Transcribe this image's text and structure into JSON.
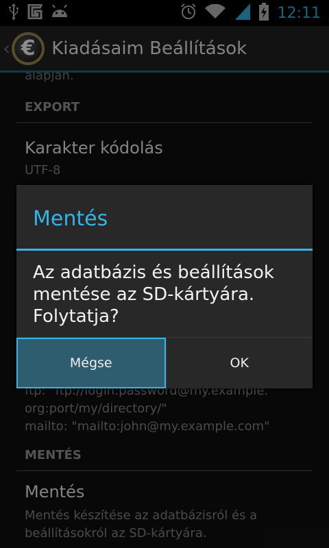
{
  "status_bar": {
    "time": "12:11"
  },
  "action_bar": {
    "logo_symbol": "€",
    "title": "Kiadásaim Beállítások"
  },
  "content": {
    "cut_text": "alapján.",
    "section_export": "EXPORT",
    "encoding": {
      "title": "Karakter kódolás",
      "value": "UTF-8"
    },
    "behind_dialog_lines": [
      "ftp: \"ftp://login:password@my.example.",
      "org:port/my/directory/\"",
      "mailto: \"mailto:john@my.example.com\""
    ],
    "section_backup": "MENTÉS",
    "backup": {
      "title": "Mentés",
      "summary_lines": [
        "Mentés készítése az adatbázisról és a",
        "beállításokról az SD-kártyára."
      ]
    }
  },
  "dialog": {
    "title": "Mentés",
    "message_lines": [
      "Az adatbázis és beállítások",
      "mentése az SD-kártyára.",
      "Folytatja?"
    ],
    "cancel_label": "Mégse",
    "ok_label": "OK"
  },
  "colors": {
    "accent": "#33b5e5",
    "pressed_bg": "#2f5d70"
  },
  "icons": [
    "usb-icon",
    "g-icon",
    "android-icon",
    "alarm-icon",
    "wifi-icon",
    "signal-icon",
    "battery-icon"
  ]
}
